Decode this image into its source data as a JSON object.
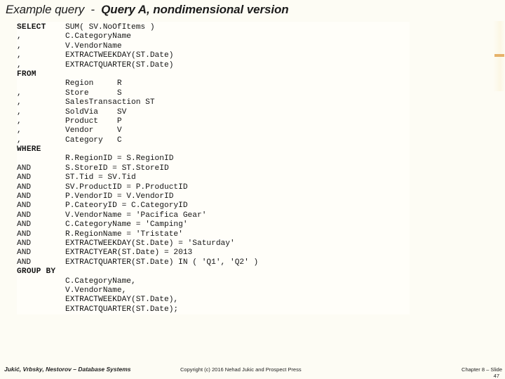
{
  "slide": {
    "title_plain": "Example query  -  ",
    "title_strong": "Query A, nondimensional version"
  },
  "accent": {
    "bar_color": "#e6b26a"
  },
  "code": {
    "language": "sql",
    "lines": [
      {
        "keyword": "SELECT",
        "bold": true,
        "expr": "SUM( SV.NoOfItems )"
      },
      {
        "keyword": ",",
        "bold": false,
        "expr": "C.CategoryName"
      },
      {
        "keyword": ",",
        "bold": false,
        "expr": "V.VendorName"
      },
      {
        "keyword": ",",
        "bold": false,
        "expr": "EXTRACTWEEKDAY(ST.Date)"
      },
      {
        "keyword": ",",
        "bold": false,
        "expr": "EXTRACTQUARTER(ST.Date)"
      },
      {
        "keyword": "FROM",
        "bold": true,
        "expr": ""
      },
      {
        "keyword": "",
        "bold": false,
        "expr": "Region     R"
      },
      {
        "keyword": ",",
        "bold": false,
        "expr": "Store      S"
      },
      {
        "keyword": ",",
        "bold": false,
        "expr": "SalesTransaction ST"
      },
      {
        "keyword": ",",
        "bold": false,
        "expr": "SoldVia    SV"
      },
      {
        "keyword": ",",
        "bold": false,
        "expr": "Product    P"
      },
      {
        "keyword": ",",
        "bold": false,
        "expr": "Vendor     V"
      },
      {
        "keyword": ",",
        "bold": false,
        "expr": "Category   C"
      },
      {
        "keyword": "WHERE",
        "bold": true,
        "expr": ""
      },
      {
        "keyword": "",
        "bold": false,
        "expr": "R.RegionID = S.RegionID"
      },
      {
        "keyword": "AND",
        "bold": false,
        "expr": "S.StoreID = ST.StoreID"
      },
      {
        "keyword": "AND",
        "bold": false,
        "expr": "ST.Tid = SV.Tid"
      },
      {
        "keyword": "AND",
        "bold": false,
        "expr": "SV.ProductID = P.ProductID"
      },
      {
        "keyword": "AND",
        "bold": false,
        "expr": "P.VendorID = V.VendorID"
      },
      {
        "keyword": "AND",
        "bold": false,
        "expr": "P.CateoryID = C.CategoryID"
      },
      {
        "keyword": "AND",
        "bold": false,
        "expr": "V.VendorName = 'Pacifica Gear'"
      },
      {
        "keyword": "AND",
        "bold": false,
        "expr": "C.CategoryName = 'Camping'"
      },
      {
        "keyword": "AND",
        "bold": false,
        "expr": "R.RegionName = 'Tristate'"
      },
      {
        "keyword": "AND",
        "bold": false,
        "expr": "EXTRACTWEEKDAY(St.Date) = 'Saturday'"
      },
      {
        "keyword": "AND",
        "bold": false,
        "expr": "EXTRACTYEAR(ST.Date) = 2013"
      },
      {
        "keyword": "AND",
        "bold": false,
        "expr": "EXTRACTQUARTER(ST.Date) IN ( 'Q1', 'Q2' )"
      },
      {
        "keyword": "GROUP BY",
        "bold": true,
        "expr": ""
      },
      {
        "keyword": "",
        "bold": false,
        "expr": "C.CategoryName,"
      },
      {
        "keyword": "",
        "bold": false,
        "expr": "V.VendorName,"
      },
      {
        "keyword": "",
        "bold": false,
        "expr": "EXTRACTWEEKDAY(ST.Date),"
      },
      {
        "keyword": "",
        "bold": false,
        "expr": "EXTRACTQUARTER(ST.Date);"
      }
    ]
  },
  "footer": {
    "left": "Jukić, Vrbsky, Nestorov – Database Systems",
    "center": "Copyright (c) 2016 Nehad Jukic and Prospect Press",
    "right": "Chapter 8 – Slide",
    "slide_number": "47"
  }
}
